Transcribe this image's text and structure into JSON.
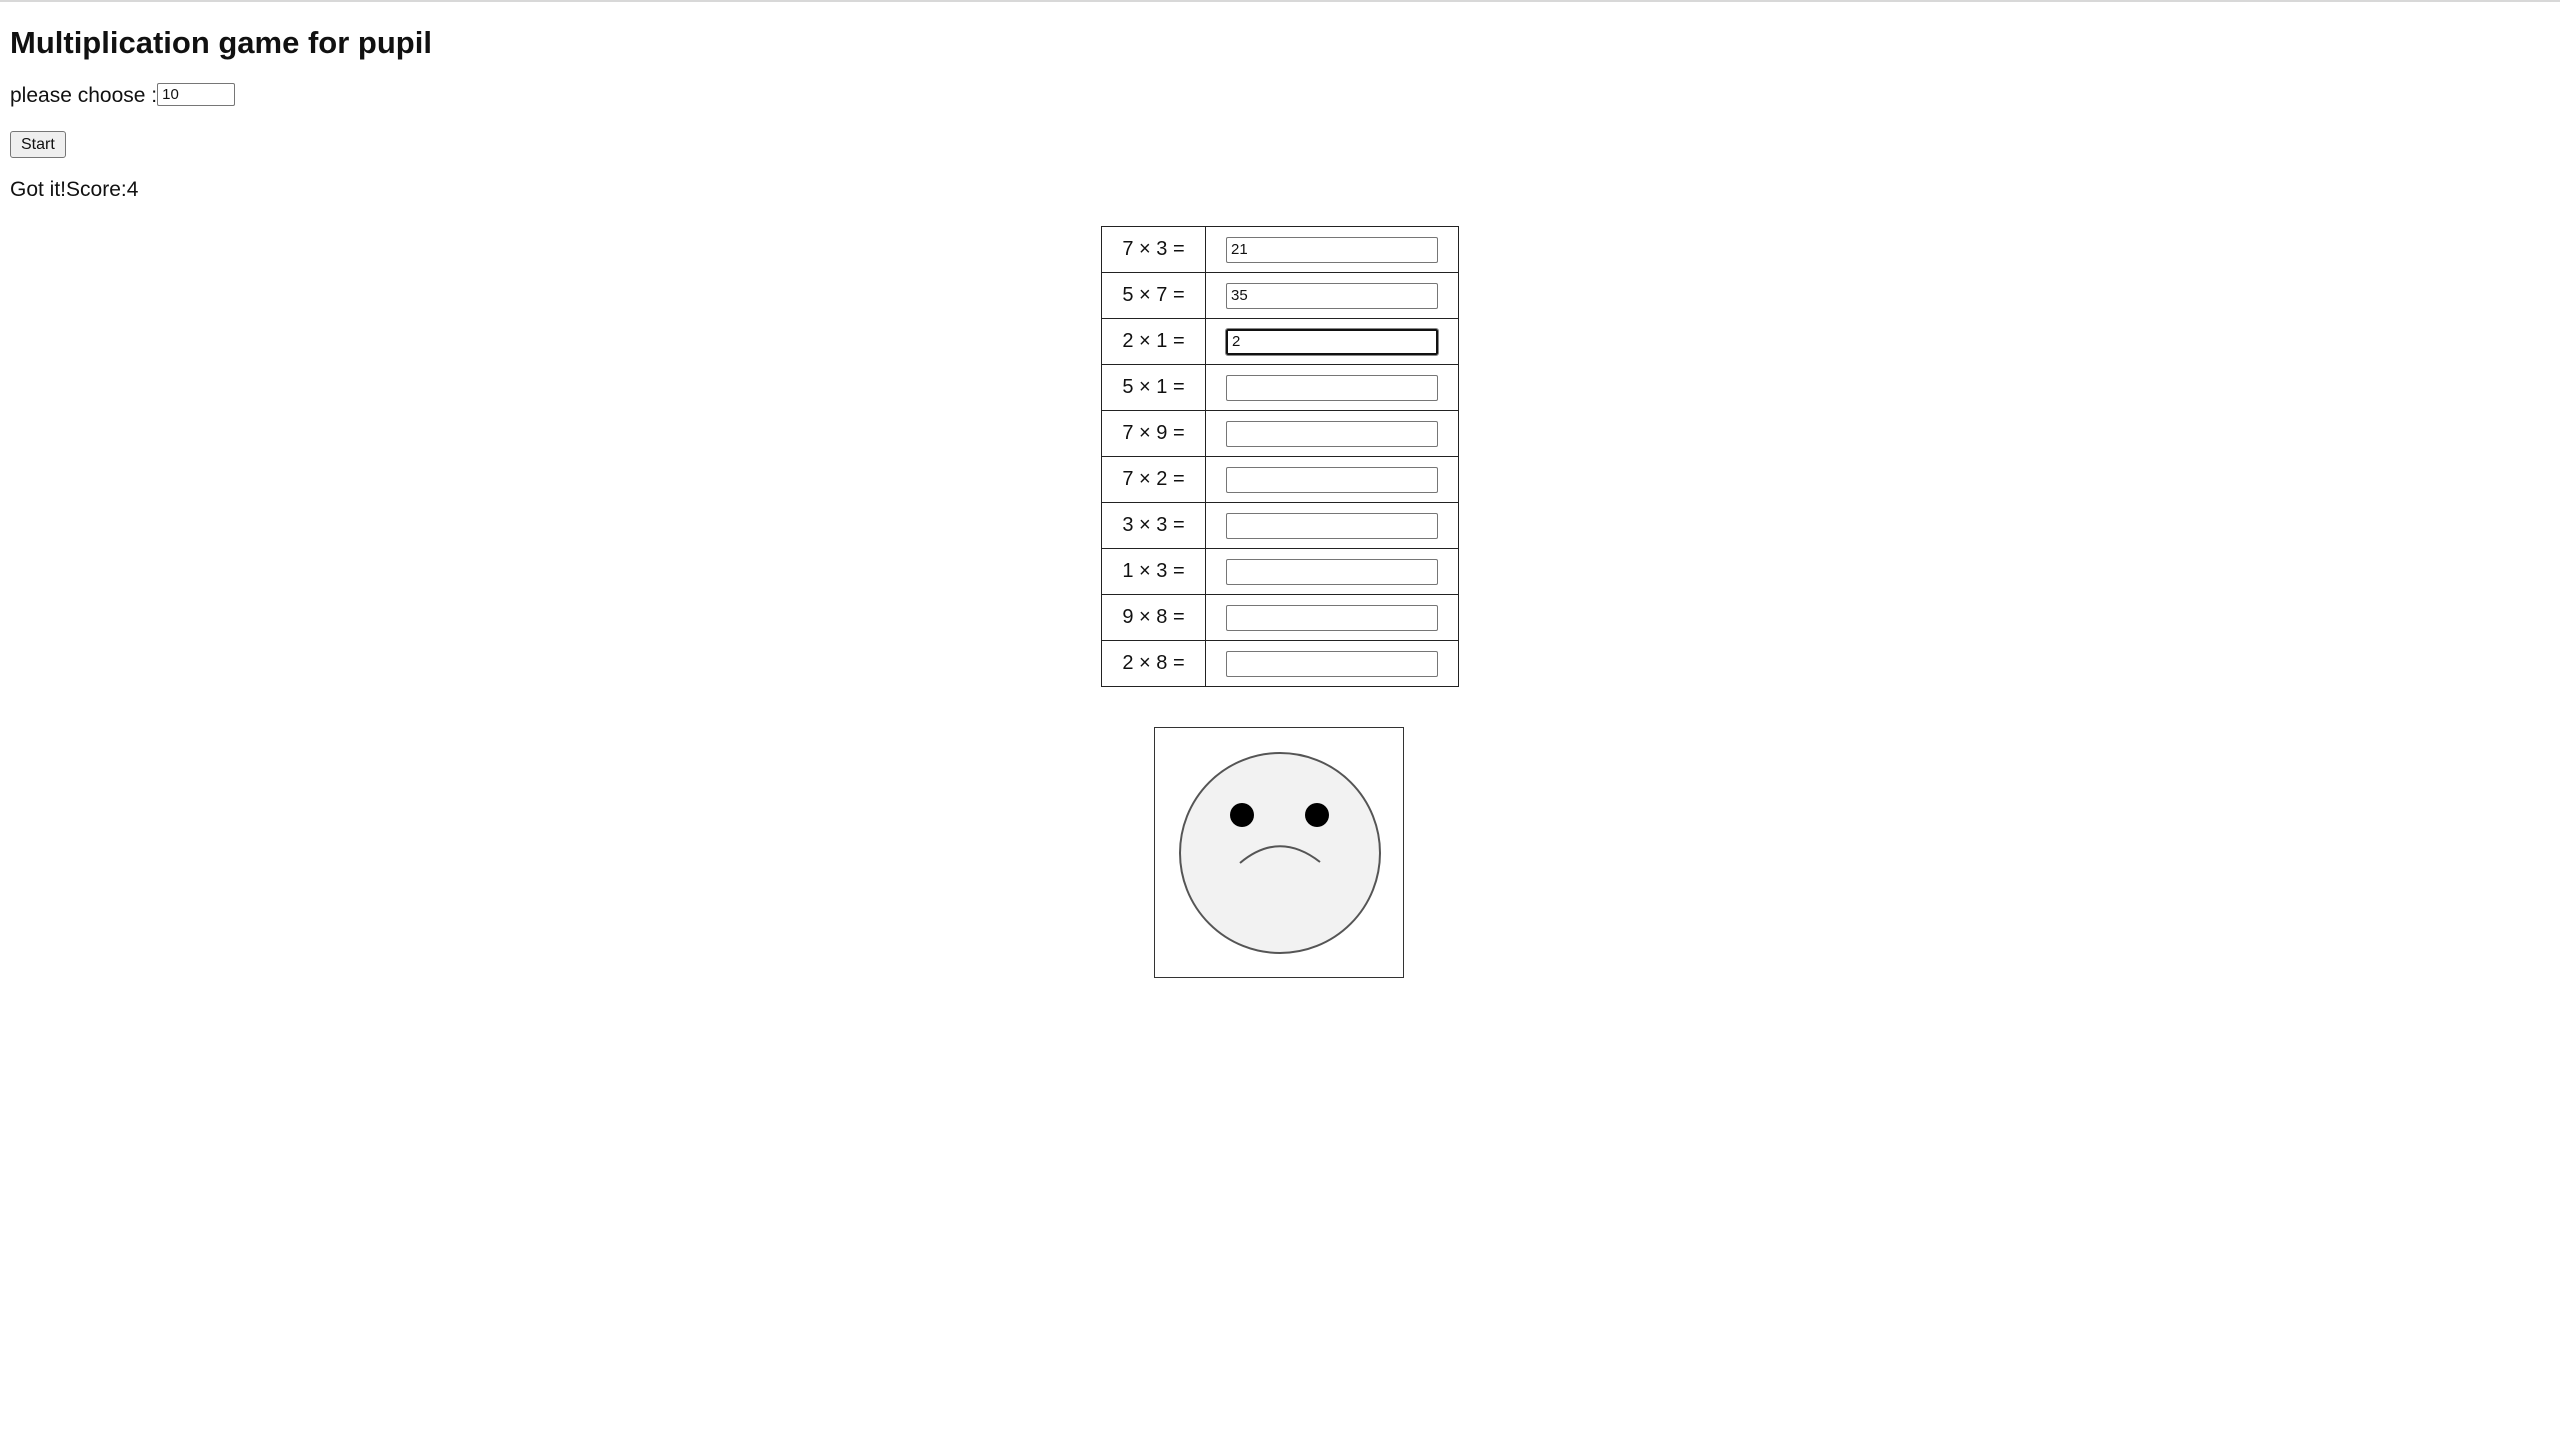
{
  "header": {
    "title": "Multiplication game for pupil"
  },
  "setup": {
    "choose_label": "please choose :",
    "count_value": "10",
    "start_label": "Start"
  },
  "status": {
    "message": "Got it!Score:4"
  },
  "questions": [
    {
      "label": "7 × 3 =",
      "answer": "21"
    },
    {
      "label": "5 × 7 =",
      "answer": "35"
    },
    {
      "label": "2 × 1 =",
      "answer": "2"
    },
    {
      "label": "5 × 1 =",
      "answer": ""
    },
    {
      "label": "7 × 9 =",
      "answer": ""
    },
    {
      "label": "7 × 2 =",
      "answer": ""
    },
    {
      "label": "3 × 3 =",
      "answer": ""
    },
    {
      "label": "1 × 3 =",
      "answer": ""
    },
    {
      "label": "9 × 8 =",
      "answer": ""
    },
    {
      "label": "2 × 8 =",
      "answer": ""
    }
  ],
  "face": {
    "icon": "sad-face-icon",
    "fill": "#f2f2f2",
    "stroke": "#555555",
    "eye": "#000000"
  }
}
